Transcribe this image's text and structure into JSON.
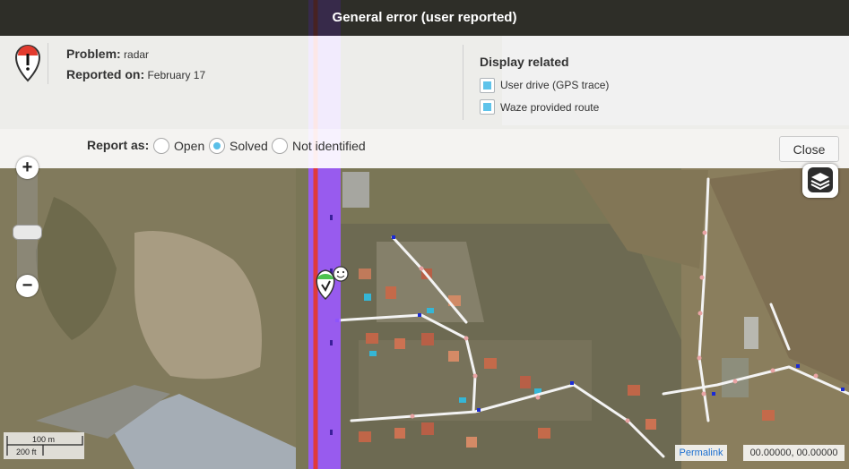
{
  "titlebar": {
    "title": "General error (user reported)"
  },
  "problem": {
    "label": "Problem:",
    "value": "radar"
  },
  "reported": {
    "label": "Reported on:",
    "value": "February 17"
  },
  "display_related": {
    "title": "Display related",
    "options": [
      {
        "label": "User drive (GPS trace)",
        "checked": true
      },
      {
        "label": "Waze provided route",
        "checked": true
      }
    ]
  },
  "report_as": {
    "label": "Report as:",
    "options": [
      {
        "label": "Open",
        "selected": false
      },
      {
        "label": "Solved",
        "selected": true
      },
      {
        "label": "Not identified",
        "selected": false
      }
    ]
  },
  "close_label": "Close",
  "zoom": {
    "in_label": "+",
    "out_label": "−",
    "level": 0.52
  },
  "scale": {
    "metric": "100 m",
    "imperial": "200 ft"
  },
  "permalink_label": "Permalink",
  "coordinates": "00.00000, 00.00000",
  "colors": {
    "route": "#9b59ff",
    "gps_trace": "#e03a3a",
    "checkbox_fill": "#5ec3ea",
    "titlebar": "#1c1c1c"
  }
}
